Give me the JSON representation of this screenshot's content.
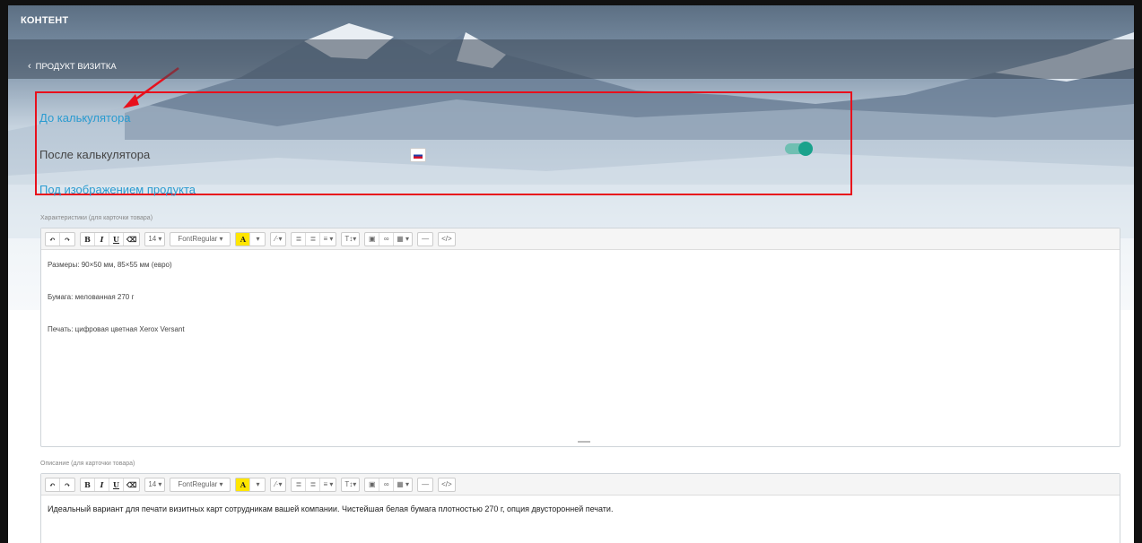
{
  "header": {
    "title": "КОНТЕНТ"
  },
  "breadcrumb": {
    "back_icon": "‹",
    "label": "ПРОДУКТ ВИЗИТКА"
  },
  "sections": {
    "before_calc": "До калькулятора",
    "after_calc": "После калькулятора",
    "under_image": "Под изображением продукта"
  },
  "toggle": {
    "state": "on",
    "color": "#1aa28c"
  },
  "flag": {
    "name": "russian-flag-icon"
  },
  "characteristics": {
    "label": "Характеристики (для карточки товара)",
    "lines": [
      "Размеры: 90×50 мм, 85×55 мм (евро)",
      "Бумага: мелованная 270 г",
      "Печать: цифровая цветная Xerox Versant"
    ]
  },
  "description": {
    "label": "Описание (для карточки товара)",
    "text": "Идеальный вариант для печати визитных карт сотрудникам вашей компании. Чистейшая белая бумага плотностью 270 г, опция двусторонней печати."
  },
  "toolbar": {
    "undo": "↶",
    "redo": "↷",
    "bold": "B",
    "italic": "I",
    "underline": "U",
    "eraser": "⌫",
    "font_size": "14 ▾",
    "font_name": "FontRegular ▾",
    "color": "A",
    "color_caret": "▾",
    "magic": "⁄·▾",
    "ul": "≣",
    "ol": "≣",
    "align": "≡ ▾",
    "text_style": "T↕▾",
    "image": "▣",
    "link": "∞",
    "table": "▦ ▾",
    "hr": "—",
    "code": "</>"
  }
}
